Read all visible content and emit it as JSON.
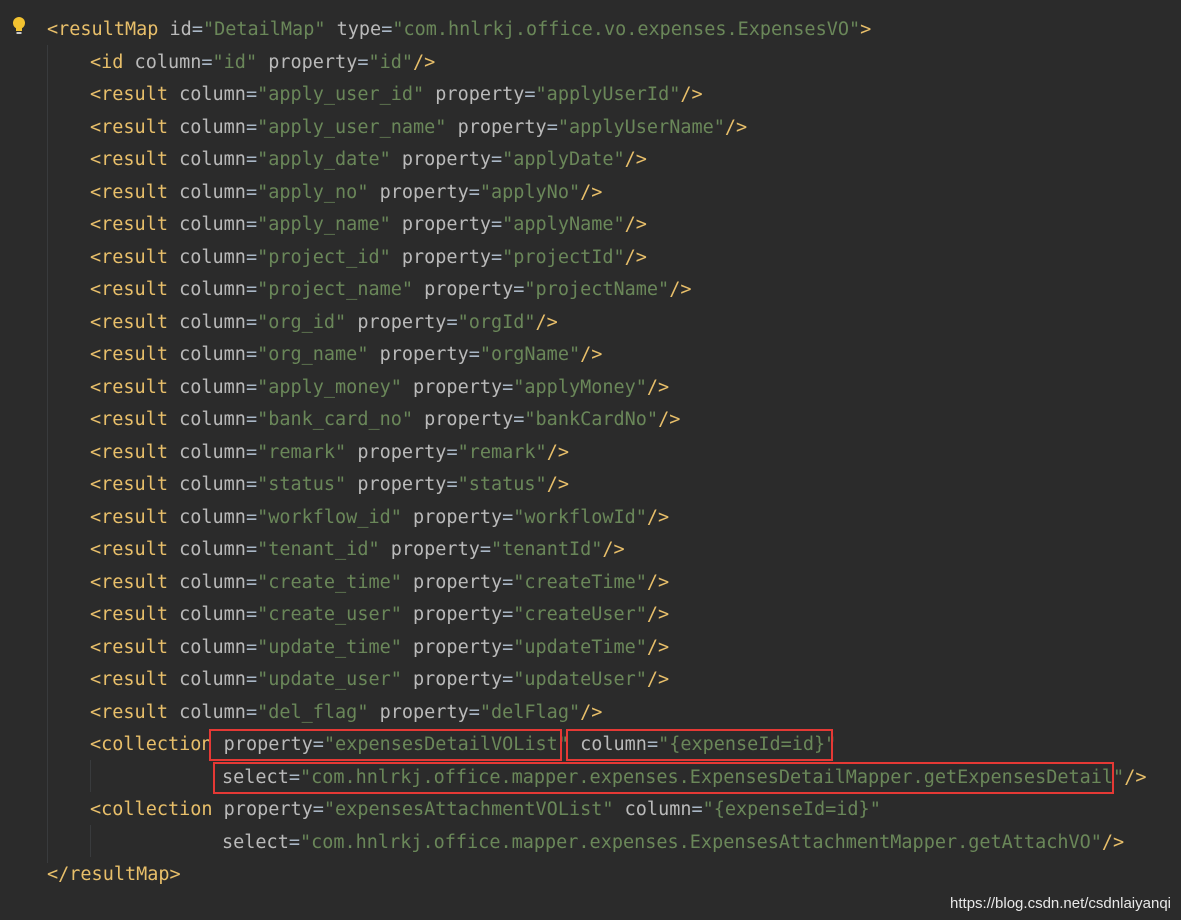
{
  "editor": {
    "lines": [
      [
        "<resultMap",
        " id",
        "=",
        "\"DetailMap\"",
        " type",
        "=",
        "\"com.hnlrkj.office.vo.expenses.ExpensesVO\"",
        ">"
      ],
      [
        "<id",
        " column",
        "=",
        "\"id\"",
        " property",
        "=",
        "\"id\"",
        "/>"
      ],
      [
        "<result",
        " column",
        "=",
        "\"apply_user_id\"",
        " property",
        "=",
        "\"applyUserId\"",
        "/>"
      ],
      [
        "<result",
        " column",
        "=",
        "\"apply_user_name\"",
        " property",
        "=",
        "\"applyUserName\"",
        "/>"
      ],
      [
        "<result",
        " column",
        "=",
        "\"apply_date\"",
        " property",
        "=",
        "\"applyDate\"",
        "/>"
      ],
      [
        "<result",
        " column",
        "=",
        "\"apply_no\"",
        " property",
        "=",
        "\"applyNo\"",
        "/>"
      ],
      [
        "<result",
        " column",
        "=",
        "\"apply_name\"",
        " property",
        "=",
        "\"applyName\"",
        "/>"
      ],
      [
        "<result",
        " column",
        "=",
        "\"project_id\"",
        " property",
        "=",
        "\"projectId\"",
        "/>"
      ],
      [
        "<result",
        " column",
        "=",
        "\"project_name\"",
        " property",
        "=",
        "\"projectName\"",
        "/>"
      ],
      [
        "<result",
        " column",
        "=",
        "\"org_id\"",
        " property",
        "=",
        "\"orgId\"",
        "/>"
      ],
      [
        "<result",
        " column",
        "=",
        "\"org_name\"",
        " property",
        "=",
        "\"orgName\"",
        "/>"
      ],
      [
        "<result",
        " column",
        "=",
        "\"apply_money\"",
        " property",
        "=",
        "\"applyMoney\"",
        "/>"
      ],
      [
        "<result",
        " column",
        "=",
        "\"bank_card_no\"",
        " property",
        "=",
        "\"bankCardNo\"",
        "/>"
      ],
      [
        "<result",
        " column",
        "=",
        "\"remark\"",
        " property",
        "=",
        "\"remark\"",
        "/>"
      ],
      [
        "<result",
        " column",
        "=",
        "\"status\"",
        " property",
        "=",
        "\"status\"",
        "/>"
      ],
      [
        "<result",
        " column",
        "=",
        "\"workflow_id\"",
        " property",
        "=",
        "\"workflowId\"",
        "/>"
      ],
      [
        "<result",
        " column",
        "=",
        "\"tenant_id\"",
        " property",
        "=",
        "\"tenantId\"",
        "/>"
      ],
      [
        "<result",
        " column",
        "=",
        "\"create_time\"",
        " property",
        "=",
        "\"createTime\"",
        "/>"
      ],
      [
        "<result",
        " column",
        "=",
        "\"create_user\"",
        " property",
        "=",
        "\"createUser\"",
        "/>"
      ],
      [
        "<result",
        " column",
        "=",
        "\"update_time\"",
        " property",
        "=",
        "\"updateTime\"",
        "/>"
      ],
      [
        "<result",
        " column",
        "=",
        "\"update_user\"",
        " property",
        "=",
        "\"updateUser\"",
        "/>"
      ],
      [
        "<result",
        " column",
        "=",
        "\"del_flag\"",
        " property",
        "=",
        "\"delFlag\"",
        "/>"
      ],
      [
        "<collection",
        " property",
        "=",
        "\"expensesDetailVOList\"",
        " column",
        "=",
        "\"{expenseId=id}\"",
        ""
      ],
      [
        "",
        "select",
        "=",
        "\"com.hnlrkj.office.mapper.expenses.ExpensesDetailMapper.getExpensesDetail\"",
        "",
        "",
        "",
        "/>"
      ],
      [
        "<collection",
        " property",
        "=",
        "\"expensesAttachmentVOList\"",
        " column",
        "=",
        "\"{expenseId=id}\"",
        ""
      ],
      [
        "",
        "select",
        "=",
        "\"com.hnlrkj.office.mapper.expenses.ExpensesAttachmentMapper.getAttachVO\"",
        "",
        "",
        "",
        "/>"
      ],
      [
        "</resultMap>",
        "",
        "",
        "",
        "",
        "",
        "",
        ""
      ]
    ]
  },
  "watermark": "https://blog.csdn.net/csdnlaiyanqi",
  "colors": {
    "background": "#2b2b2b",
    "tag": "#e8bf6a",
    "attribute": "#bababa",
    "value": "#6a8759",
    "highlight_box": "#e53935"
  },
  "icons": {
    "gutter": "lightbulb-icon"
  }
}
